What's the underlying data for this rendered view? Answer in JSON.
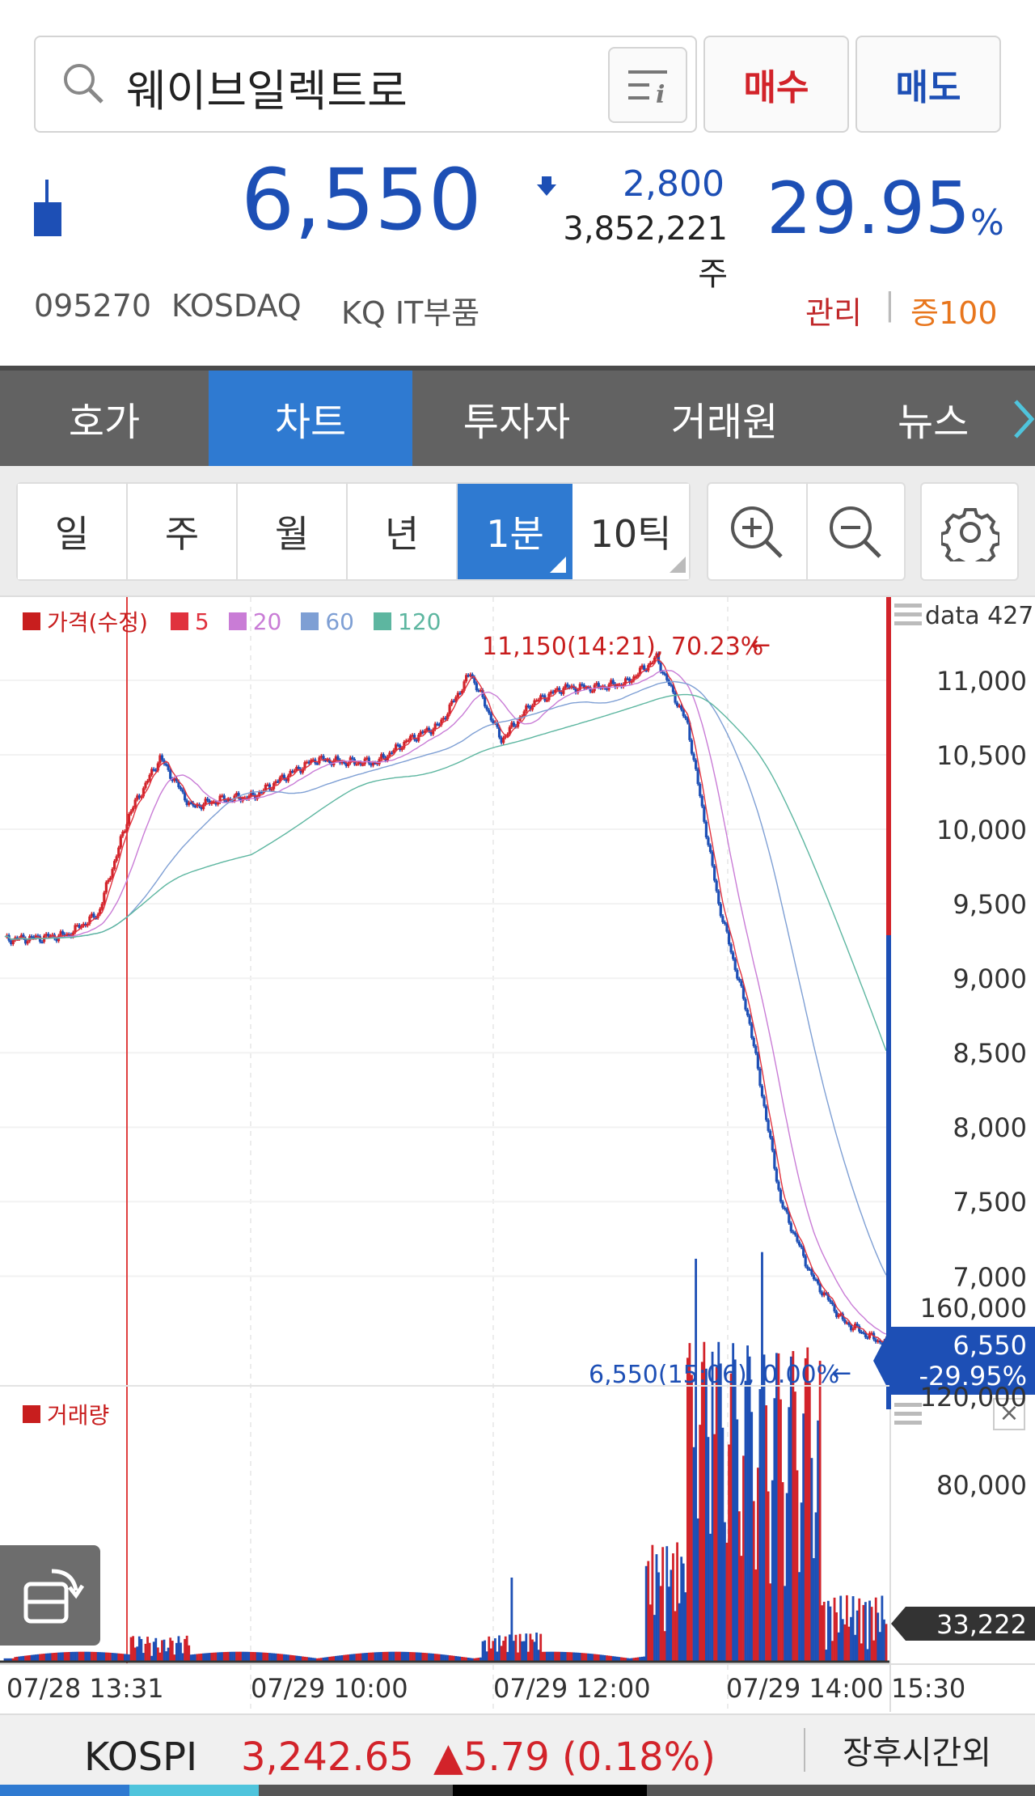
{
  "search": {
    "query": "웨이브일렉트로"
  },
  "actions": {
    "buy": "매수",
    "sell": "매도"
  },
  "quote": {
    "price": "6,550",
    "change": "2,800",
    "volume": "3,852,221주",
    "pct": "29.95",
    "pct_unit": "%"
  },
  "stock_info": {
    "code": "095270",
    "market": "KOSDAQ",
    "sector": "KQ IT부품",
    "tag1": "관리",
    "tag2": "증100"
  },
  "tabs": [
    "호가",
    "차트",
    "투자자",
    "거래원",
    "뉴스"
  ],
  "periods": [
    "일",
    "주",
    "월",
    "년",
    "1분",
    "10틱"
  ],
  "legend": {
    "price": "가격(수정)",
    "ma5": "5",
    "ma20": "20",
    "ma60": "60",
    "ma120": "120"
  },
  "data_count": "data 427",
  "annotations": {
    "high": "11,150(14:21), 70.23%",
    "last": "6,550(15:06), 0.00%"
  },
  "current_tag": {
    "price": "6,550",
    "pct": "-29.95%"
  },
  "volume_title": "거래량",
  "volume_tag": "33,222",
  "x_labels": [
    "07/28 13:31",
    "07/29 10:00",
    "07/29 12:00",
    "07/29 14:00",
    "15:30"
  ],
  "index_bar": {
    "name": "KOSPI",
    "value": "3,242.65",
    "change": "▲5.79 (0.18%)",
    "after": "장후시간외"
  },
  "colors": {
    "up": "#d2232a",
    "down": "#1d4fb5",
    "tab_active": "#2f7ad1",
    "tab_bar": "#626262"
  },
  "chart_data": [
    {
      "type": "line",
      "title": "가격(수정)",
      "x_ticks": [
        "07/28 13:31",
        "07/29 10:00",
        "07/29 12:00",
        "07/29 14:00",
        "15:30"
      ],
      "ylim": [
        6400,
        11450
      ],
      "y_ticks": [
        7000,
        7500,
        8000,
        8500,
        9000,
        9500,
        10000,
        10500,
        11000
      ],
      "series": [
        {
          "name": "가격(수정)",
          "x": [
            0,
            15,
            30,
            45,
            60,
            75,
            90,
            105,
            120,
            135,
            150,
            165,
            180,
            195,
            210,
            225,
            240,
            255,
            270,
            285,
            300,
            315,
            330,
            345,
            360,
            375,
            390,
            405,
            420,
            426
          ],
          "values": [
            9260,
            9270,
            9290,
            9430,
            10100,
            10480,
            10150,
            10200,
            10220,
            10350,
            10470,
            10450,
            10450,
            10600,
            10700,
            11050,
            10600,
            10850,
            10950,
            10950,
            10980,
            11150,
            10700,
            9500,
            8700,
            7500,
            7000,
            6700,
            6580,
            6550
          ]
        }
      ],
      "high": {
        "value": 11150,
        "time": "14:21",
        "pct": 70.23
      },
      "last": {
        "value": 6550,
        "time": "15:06",
        "pct": 0.0
      }
    },
    {
      "type": "bar",
      "title": "거래량",
      "y_ticks": [
        80000,
        120000,
        160000
      ],
      "last_value": 33222
    }
  ]
}
